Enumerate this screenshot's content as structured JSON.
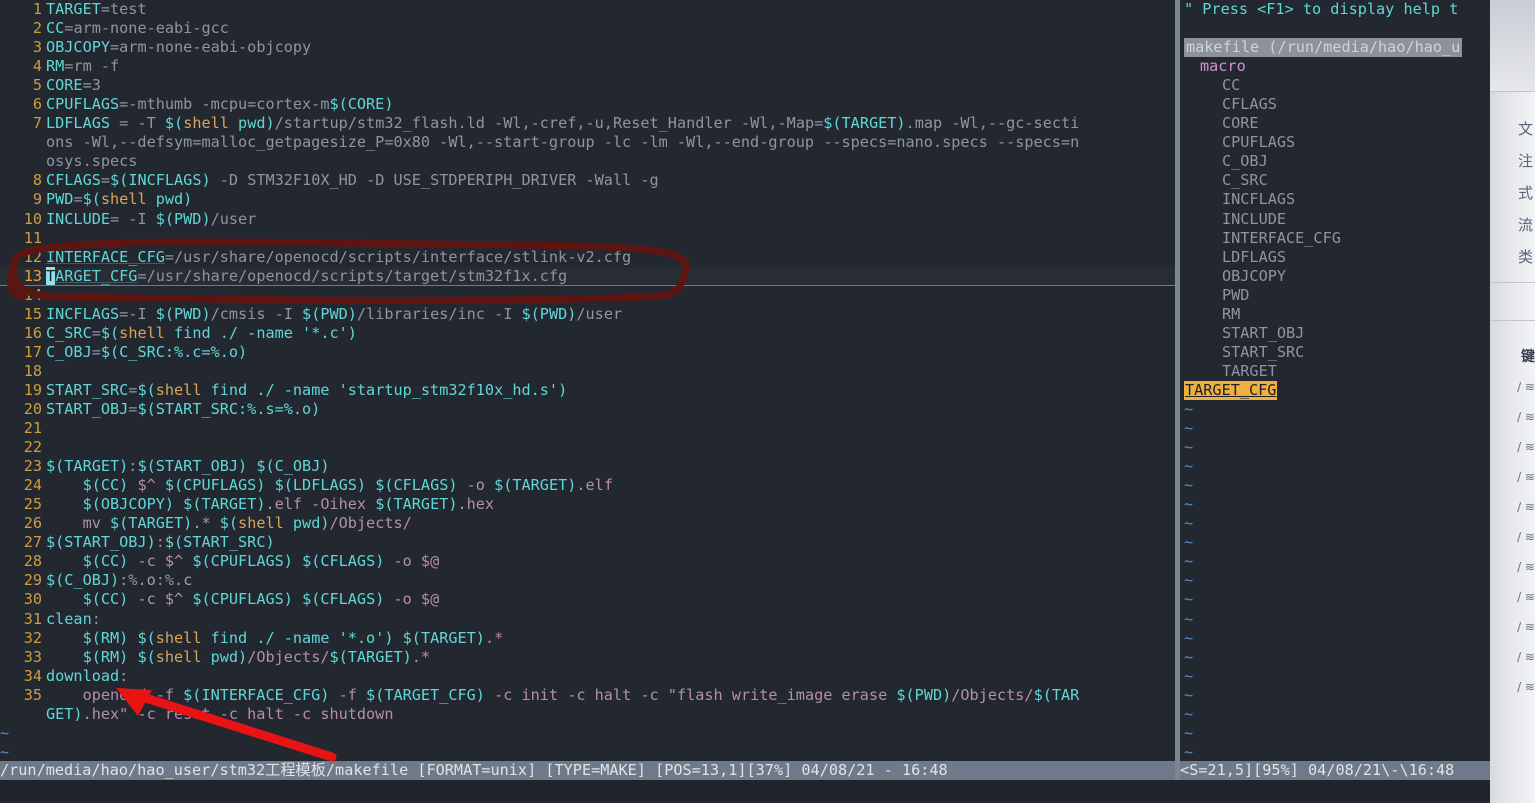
{
  "app": {
    "name": "vim",
    "colors": {
      "background": "#232830",
      "status_bar": "#6e7a89",
      "line_number": "#cf9d3a",
      "identifier_cyan": "#5fd7d7",
      "shell_keyword": "#d8a657",
      "string_purple": "#b48ead",
      "tilde_blue": "#4f8ccf",
      "tag_selected": "#f0b040",
      "annotation_circle": "#5e1512",
      "annotation_arrow": "#e81414"
    }
  },
  "editor": {
    "lines": [
      {
        "n": "1",
        "segs": [
          {
            "t": "TARGET",
            "c": "t-var"
          },
          {
            "t": "=test",
            "c": "t-plain"
          }
        ]
      },
      {
        "n": "2",
        "segs": [
          {
            "t": "CC",
            "c": "t-var"
          },
          {
            "t": "=arm-none-eabi-gcc",
            "c": "t-plain"
          }
        ]
      },
      {
        "n": "3",
        "segs": [
          {
            "t": "OBJCOPY",
            "c": "t-var"
          },
          {
            "t": "=arm-none-eabi-objcopy",
            "c": "t-plain"
          }
        ]
      },
      {
        "n": "4",
        "segs": [
          {
            "t": "RM",
            "c": "t-var"
          },
          {
            "t": "=rm -f",
            "c": "t-plain"
          }
        ]
      },
      {
        "n": "5",
        "segs": [
          {
            "t": "CORE",
            "c": "t-var"
          },
          {
            "t": "=3",
            "c": "t-plain"
          }
        ]
      },
      {
        "n": "6",
        "segs": [
          {
            "t": "CPUFLAGS",
            "c": "t-var"
          },
          {
            "t": "=-mthumb -mcpu=cortex-m",
            "c": "t-plain"
          },
          {
            "t": "$(CORE)",
            "c": "t-var"
          }
        ]
      },
      {
        "n": "7",
        "segs": [
          {
            "t": "LDFLAGS",
            "c": "t-var"
          },
          {
            "t": " = -T ",
            "c": "t-plain"
          },
          {
            "t": "$(",
            "c": "t-var"
          },
          {
            "t": "shell",
            "c": "t-fn"
          },
          {
            "t": " pwd)",
            "c": "t-var"
          },
          {
            "t": "/startup/stm32_flash.ld -Wl,-cref,-u,Reset_Handler -Wl,-Map=",
            "c": "t-plain"
          },
          {
            "t": "$(TARGET)",
            "c": "t-var"
          },
          {
            "t": ".map -Wl,--gc-secti",
            "c": "t-plain"
          }
        ]
      },
      {
        "n": "",
        "segs": [
          {
            "t": "ons -Wl,--defsym=malloc_getpagesize_P=0x80 -Wl,--start-group -lc -lm -Wl,--end-group --specs=nano.specs --specs=n",
            "c": "t-plain"
          }
        ]
      },
      {
        "n": "",
        "segs": [
          {
            "t": "osys.specs",
            "c": "t-plain"
          }
        ]
      },
      {
        "n": "8",
        "segs": [
          {
            "t": "CFLAGS",
            "c": "t-var"
          },
          {
            "t": "=",
            "c": "t-plain"
          },
          {
            "t": "$(INCFLAGS)",
            "c": "t-var"
          },
          {
            "t": " -D STM32F10X_HD -D USE_STDPERIPH_DRIVER -Wall -g",
            "c": "t-plain"
          }
        ]
      },
      {
        "n": "9",
        "segs": [
          {
            "t": "PWD",
            "c": "t-var"
          },
          {
            "t": "=",
            "c": "t-plain"
          },
          {
            "t": "$(",
            "c": "t-var"
          },
          {
            "t": "shell",
            "c": "t-fn"
          },
          {
            "t": " pwd)",
            "c": "t-var"
          }
        ]
      },
      {
        "n": "10",
        "segs": [
          {
            "t": "INCLUDE",
            "c": "t-var"
          },
          {
            "t": "= -I ",
            "c": "t-plain"
          },
          {
            "t": "$(PWD)",
            "c": "t-var"
          },
          {
            "t": "/user",
            "c": "t-plain"
          }
        ]
      },
      {
        "n": "11",
        "segs": []
      },
      {
        "n": "12",
        "segs": [
          {
            "t": "INTERFACE_CFG",
            "c": "t-var uline"
          },
          {
            "t": "=/usr/share/openocd/scripts/interface/stlink-v2.cfg",
            "c": "t-plain"
          }
        ]
      },
      {
        "n": "13",
        "cursor": true,
        "segs": [
          {
            "t": "T",
            "c": "vcursor"
          },
          {
            "t": "ARGET_CFG",
            "c": "t-var uline"
          },
          {
            "t": "=/usr/share/openocd/scripts/target/stm32f1x.cfg",
            "c": "t-plain"
          }
        ]
      },
      {
        "n": "14",
        "segs": []
      },
      {
        "n": "15",
        "segs": [
          {
            "t": "INCFLAGS",
            "c": "t-var"
          },
          {
            "t": "=-I ",
            "c": "t-plain"
          },
          {
            "t": "$(PWD)",
            "c": "t-var"
          },
          {
            "t": "/cmsis -I ",
            "c": "t-plain"
          },
          {
            "t": "$(PWD)",
            "c": "t-var"
          },
          {
            "t": "/libraries/inc -I ",
            "c": "t-plain"
          },
          {
            "t": "$(PWD)",
            "c": "t-var"
          },
          {
            "t": "/user",
            "c": "t-plain"
          }
        ]
      },
      {
        "n": "16",
        "segs": [
          {
            "t": "C_SRC",
            "c": "t-var"
          },
          {
            "t": "=",
            "c": "t-plain"
          },
          {
            "t": "$(",
            "c": "t-var"
          },
          {
            "t": "shell",
            "c": "t-fn"
          },
          {
            "t": " find ./ -name '*.c')",
            "c": "t-var"
          }
        ]
      },
      {
        "n": "17",
        "segs": [
          {
            "t": "C_OBJ",
            "c": "t-var"
          },
          {
            "t": "=",
            "c": "t-plain"
          },
          {
            "t": "$(C_SRC:%.c=%.o)",
            "c": "t-var"
          }
        ]
      },
      {
        "n": "18",
        "segs": []
      },
      {
        "n": "19",
        "segs": [
          {
            "t": "START_SRC",
            "c": "t-var"
          },
          {
            "t": "=",
            "c": "t-plain"
          },
          {
            "t": "$(",
            "c": "t-var"
          },
          {
            "t": "shell",
            "c": "t-fn"
          },
          {
            "t": " find ./ -name 'startup_stm32f10x_hd.s')",
            "c": "t-var"
          }
        ]
      },
      {
        "n": "20",
        "segs": [
          {
            "t": "START_OBJ",
            "c": "t-var"
          },
          {
            "t": "=",
            "c": "t-plain"
          },
          {
            "t": "$(START_SRC:%.s=%.o)",
            "c": "t-var"
          }
        ]
      },
      {
        "n": "21",
        "segs": []
      },
      {
        "n": "22",
        "segs": []
      },
      {
        "n": "23",
        "segs": [
          {
            "t": "$(TARGET)",
            "c": "t-var"
          },
          {
            "t": ":",
            "c": "t-plain"
          },
          {
            "t": "$(START_OBJ)",
            "c": "t-var"
          },
          {
            "t": " ",
            "c": "t-plain"
          },
          {
            "t": "$(C_OBJ)",
            "c": "t-var"
          }
        ]
      },
      {
        "n": "24",
        "segs": [
          {
            "t": "    ",
            "c": "t-plain"
          },
          {
            "t": "$(CC)",
            "c": "t-var"
          },
          {
            "t": " $^ ",
            "c": "t-str"
          },
          {
            "t": "$(CPUFLAGS)",
            "c": "t-var"
          },
          {
            "t": " ",
            "c": "t-str"
          },
          {
            "t": "$(LDFLAGS)",
            "c": "t-var"
          },
          {
            "t": " ",
            "c": "t-str"
          },
          {
            "t": "$(CFLAGS)",
            "c": "t-var"
          },
          {
            "t": " -o ",
            "c": "t-str"
          },
          {
            "t": "$(TARGET)",
            "c": "t-var"
          },
          {
            "t": ".elf",
            "c": "t-str"
          }
        ]
      },
      {
        "n": "25",
        "segs": [
          {
            "t": "    ",
            "c": "t-plain"
          },
          {
            "t": "$(OBJCOPY)",
            "c": "t-var"
          },
          {
            "t": " ",
            "c": "t-str"
          },
          {
            "t": "$(TARGET)",
            "c": "t-var"
          },
          {
            "t": ".elf -Oihex ",
            "c": "t-str"
          },
          {
            "t": "$(TARGET)",
            "c": "t-var"
          },
          {
            "t": ".hex",
            "c": "t-str"
          }
        ]
      },
      {
        "n": "26",
        "segs": [
          {
            "t": "    mv ",
            "c": "t-str"
          },
          {
            "t": "$(TARGET)",
            "c": "t-var"
          },
          {
            "t": ".* ",
            "c": "t-str"
          },
          {
            "t": "$(",
            "c": "t-var"
          },
          {
            "t": "shell",
            "c": "t-fn"
          },
          {
            "t": " pwd)",
            "c": "t-var"
          },
          {
            "t": "/Objects/",
            "c": "t-str"
          }
        ]
      },
      {
        "n": "27",
        "segs": [
          {
            "t": "$(START_OBJ)",
            "c": "t-var"
          },
          {
            "t": ":",
            "c": "t-plain"
          },
          {
            "t": "$(START_SRC)",
            "c": "t-var"
          }
        ]
      },
      {
        "n": "28",
        "segs": [
          {
            "t": "    ",
            "c": "t-plain"
          },
          {
            "t": "$(CC)",
            "c": "t-var"
          },
          {
            "t": " -c $^ ",
            "c": "t-str"
          },
          {
            "t": "$(CPUFLAGS)",
            "c": "t-var"
          },
          {
            "t": " ",
            "c": "t-str"
          },
          {
            "t": "$(CFLAGS)",
            "c": "t-var"
          },
          {
            "t": " -o $@",
            "c": "t-str"
          }
        ]
      },
      {
        "n": "29",
        "segs": [
          {
            "t": "$(C_OBJ)",
            "c": "t-var"
          },
          {
            "t": ":%",
            "c": "t-plain"
          },
          {
            "t": ".o",
            "c": "t-num"
          },
          {
            "t": ":%",
            "c": "t-plain"
          },
          {
            "t": ".c",
            "c": "t-num"
          }
        ]
      },
      {
        "n": "30",
        "segs": [
          {
            "t": "    ",
            "c": "t-plain"
          },
          {
            "t": "$(CC)",
            "c": "t-var"
          },
          {
            "t": " -c $^ ",
            "c": "t-str"
          },
          {
            "t": "$(CPUFLAGS)",
            "c": "t-var"
          },
          {
            "t": " ",
            "c": "t-str"
          },
          {
            "t": "$(CFLAGS)",
            "c": "t-var"
          },
          {
            "t": " -o $@",
            "c": "t-str"
          }
        ]
      },
      {
        "n": "31",
        "segs": [
          {
            "t": "clean",
            "c": "t-var"
          },
          {
            "t": ":",
            "c": "t-plain"
          }
        ]
      },
      {
        "n": "32",
        "segs": [
          {
            "t": "    ",
            "c": "t-plain"
          },
          {
            "t": "$(RM)",
            "c": "t-var"
          },
          {
            "t": " ",
            "c": "t-str"
          },
          {
            "t": "$(",
            "c": "t-var"
          },
          {
            "t": "shell",
            "c": "t-fn"
          },
          {
            "t": " find ./ -name '*.o')",
            "c": "t-var"
          },
          {
            "t": " ",
            "c": "t-str"
          },
          {
            "t": "$(TARGET)",
            "c": "t-var"
          },
          {
            "t": ".*",
            "c": "t-str"
          }
        ]
      },
      {
        "n": "33",
        "segs": [
          {
            "t": "    ",
            "c": "t-plain"
          },
          {
            "t": "$(RM)",
            "c": "t-var"
          },
          {
            "t": " ",
            "c": "t-str"
          },
          {
            "t": "$(",
            "c": "t-var"
          },
          {
            "t": "shell",
            "c": "t-fn"
          },
          {
            "t": " pwd)",
            "c": "t-var"
          },
          {
            "t": "/Objects/",
            "c": "t-str"
          },
          {
            "t": "$(TARGET)",
            "c": "t-var"
          },
          {
            "t": ".*",
            "c": "t-str"
          }
        ]
      },
      {
        "n": "34",
        "segs": [
          {
            "t": "download",
            "c": "t-var"
          },
          {
            "t": ":",
            "c": "t-plain"
          }
        ]
      },
      {
        "n": "35",
        "segs": [
          {
            "t": "    openocd -f ",
            "c": "t-str"
          },
          {
            "t": "$(INTERFACE_CFG)",
            "c": "t-var"
          },
          {
            "t": " -f ",
            "c": "t-str"
          },
          {
            "t": "$(TARGET_CFG)",
            "c": "t-var"
          },
          {
            "t": " -c init -c halt -c \"flash write_image erase ",
            "c": "t-str"
          },
          {
            "t": "$(PWD)",
            "c": "t-var"
          },
          {
            "t": "/Objects/",
            "c": "t-str"
          },
          {
            "t": "$(TAR",
            "c": "t-var"
          }
        ]
      },
      {
        "n": "",
        "segs": [
          {
            "t": "GET)",
            "c": "t-var"
          },
          {
            "t": ".hex\" -c reset -c halt -c shutdown",
            "c": "t-str"
          }
        ]
      }
    ],
    "empty_markers": [
      "~",
      "~",
      "~"
    ]
  },
  "tagbar": {
    "help_line": "\" Press <F1> to display help t",
    "file_header": "makefile (/run/media/hao/hao_u",
    "kind": "macro",
    "items": [
      "CC",
      "CFLAGS",
      "CORE",
      "CPUFLAGS",
      "C_OBJ",
      "C_SRC",
      "INCFLAGS",
      "INCLUDE",
      "INTERFACE_CFG",
      "LDFLAGS",
      "OBJCOPY",
      "PWD",
      "RM",
      "START_OBJ",
      "START_SRC",
      "TARGET",
      "TARGET_CFG"
    ],
    "selected": "TARGET_CFG",
    "empty_marker": "~",
    "empty_marker_count": 19
  },
  "status_left": {
    "path": "/run/media/hao/hao_user/stm32工程模板/makefile",
    "format": "[FORMAT=unix]",
    "type": "[TYPE=MAKE]",
    "pos": "[POS=13,1][37%]",
    "date": "04/08/21 - 16:48",
    "full": "/run/media/hao/hao_user/stm32工程模板/makefile [FORMAT=unix] [TYPE=MAKE] [POS=13,1][37%]  04/08/21 - 16:48"
  },
  "status_right": {
    "full": "<S=21,5][95%]  04/08/21\\-\\16:48"
  },
  "background_window": {
    "cjk_labels": [
      "文",
      "注",
      "式",
      "流",
      "类"
    ],
    "heading": "键",
    "rows": [
      "/ ≋",
      "/ ≋",
      "/ ≋",
      "/ ≋",
      "/ ≋",
      "/ ≋",
      "/ ≋",
      "/ ≋",
      "/ ≋",
      "/ ≋",
      "/ ≋"
    ]
  },
  "annotations": {
    "circle_label": "hand-drawn-dark-red-ellipse-around-lines-12-13",
    "arrow_label": "red-arrow-pointing-to-openocd-command"
  }
}
